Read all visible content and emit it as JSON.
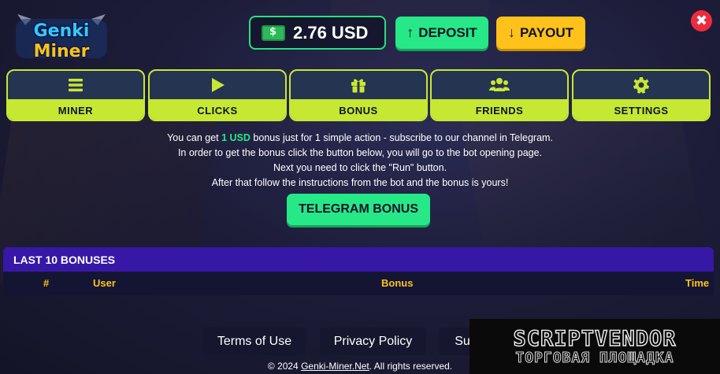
{
  "header": {
    "logo_lines": [
      "Genki",
      "Miner"
    ],
    "balance": "2.76 USD",
    "deposit_label": "DEPOSIT",
    "payout_label": "PAYOUT",
    "close_symbol": "✖"
  },
  "nav": {
    "items": [
      {
        "label": "MINER",
        "icon": "bars-icon"
      },
      {
        "label": "CLICKS",
        "icon": "play-icon"
      },
      {
        "label": "BONUS",
        "icon": "gift-icon"
      },
      {
        "label": "FRIENDS",
        "icon": "users-icon"
      },
      {
        "label": "SETTINGS",
        "icon": "gear-icon"
      }
    ]
  },
  "bonus_message": {
    "line1_prefix": "You can get ",
    "line1_highlight": "1 USD",
    "line1_suffix": " bonus just for 1 simple action - subscribe to our channel in Telegram.",
    "line2": "In order to get the bonus click the button below, you will go to the bot opening page.",
    "line3": "Next you need to click the \"Run\" button.",
    "line4": "After that follow the instructions from the bot and the bonus is yours!",
    "button_label": "TELEGRAM BONUS"
  },
  "bonuses_table": {
    "title": "LAST 10 BONUSES",
    "columns": [
      "#",
      "User",
      "Bonus",
      "Time"
    ]
  },
  "footer": {
    "links": [
      "Terms of Use",
      "Privacy Policy",
      "Su"
    ],
    "copyright_prefix": "© 2024 ",
    "copyright_link": "Genki-Miner.Net",
    "copyright_suffix": ". All rights reserved."
  },
  "watermark": {
    "line1": "SCRIPTVENDOR",
    "line2": "ТОРГОВАЯ ПЛОЩАДКА"
  },
  "colors": {
    "accent_green": "#27e887",
    "accent_yellow": "#ffc21a",
    "nav_lime": "#c7e833",
    "table_header": "#3617a6",
    "close_red": "#ee2b3d"
  }
}
